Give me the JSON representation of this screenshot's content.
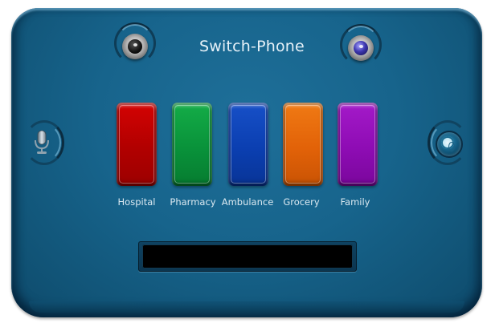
{
  "app": {
    "title": "Switch-Phone"
  },
  "tiles": [
    {
      "label": "Hospital",
      "color": "#c60000"
    },
    {
      "label": "Pharmacy",
      "color": "#0a9a3c"
    },
    {
      "label": "Ambulance",
      "color": "#0a3fb4"
    },
    {
      "label": "Grocery",
      "color": "#e26208"
    },
    {
      "label": "Family",
      "color": "#8e0cb4"
    }
  ],
  "display": {
    "text": ""
  },
  "icons": {
    "left_lens": "camera-lens-icon",
    "right_lens": "sensor-lens-icon",
    "left_button": "microphone-icon",
    "right_button": "fingerprint-icon"
  },
  "colors": {
    "body": "#17648c",
    "text": "#e6f1f8",
    "display": "#000000"
  }
}
